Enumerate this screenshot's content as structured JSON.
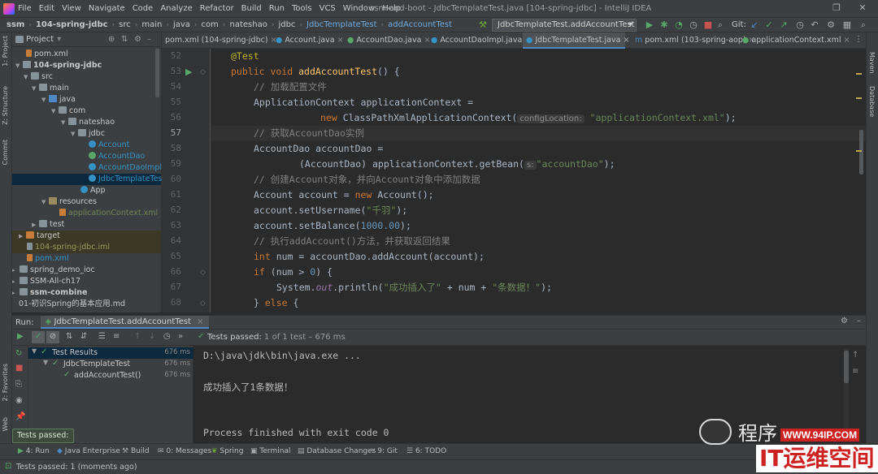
{
  "menu": [
    "File",
    "Edit",
    "View",
    "Navigate",
    "Code",
    "Analyze",
    "Refactor",
    "Build",
    "Run",
    "Tools",
    "VCS",
    "Window",
    "Help"
  ],
  "window_title": "ssm-and-boot - JdbcTemplateTest.java [104-spring-jdbc] - IntelliJ IDEA",
  "breadcrumbs": [
    "ssm",
    "104-spring-jdbc",
    "src",
    "main",
    "java",
    "com",
    "nateshao",
    "jdbc",
    "JdbcTemplateTest",
    "addAccountTest"
  ],
  "run_config": "JdbcTemplateTest.addAccountTest",
  "git_label": "Git:",
  "project_panel": {
    "title": "Project",
    "items": [
      {
        "label": "pom.xml",
        "indent": 1
      },
      {
        "label": "104-spring-jdbc",
        "indent": 0
      },
      {
        "label": "src",
        "indent": 1
      },
      {
        "label": "main",
        "indent": 2
      },
      {
        "label": "java",
        "indent": 3
      },
      {
        "label": "com",
        "indent": 4
      },
      {
        "label": "nateshao",
        "indent": 5
      },
      {
        "label": "jdbc",
        "indent": 6
      },
      {
        "label": "Account",
        "indent": 7
      },
      {
        "label": "AccountDao",
        "indent": 7
      },
      {
        "label": "AccountDaoImpl",
        "indent": 7
      },
      {
        "label": "JdbcTemplateTest",
        "indent": 7
      },
      {
        "label": "App",
        "indent": 6
      },
      {
        "label": "resources",
        "indent": 3
      },
      {
        "label": "applicationContext.xml",
        "indent": 4
      },
      {
        "label": "test",
        "indent": 2
      },
      {
        "label": "target",
        "indent": 1
      },
      {
        "label": "104-spring-jdbc.iml",
        "indent": 1
      },
      {
        "label": "pom.xml",
        "indent": 1
      },
      {
        "label": "spring_demo_ioc",
        "indent": 0
      },
      {
        "label": "SSM-All-ch17",
        "indent": 0
      },
      {
        "label": "ssm-combine",
        "indent": 0
      },
      {
        "label": "01-初识Spring的基本应用.md",
        "indent": 0
      }
    ]
  },
  "left_strip": [
    "1: Project",
    "Z: Structure",
    "Commit"
  ],
  "left_strip_bottom": [
    "2: Favorites",
    "Web"
  ],
  "right_strip": [
    "Maven",
    "Database"
  ],
  "editor_tabs": [
    "pom.xml (104-spring-jdbc)",
    "Account.java",
    "AccountDao.java",
    "AccountDaoImpl.java",
    "JdbcTemplateTest.java",
    "pom.xml (103-spring-aop)",
    "applicationContext.xml"
  ],
  "line_numbers": [
    "52",
    "53",
    "54",
    "55",
    "56",
    "57",
    "58",
    "59",
    "60",
    "61",
    "62",
    "63",
    "64",
    "65",
    "66",
    "67",
    "68"
  ],
  "code": {
    "l52": "@Test",
    "l53_kw": "public void ",
    "l53_fn": "addAccountTest",
    "l53_rest": "() {",
    "l54": "// 加载配置文件",
    "l55": "ApplicationContext applicationContext =",
    "l56_kw": "new ",
    "l56_cls": "ClassPathXmlApplicationContext(",
    "l56_hint": "configLocation:",
    "l56_str": "\"applicationContext.xml\"",
    "l56_end": ");",
    "l57": "// 获取AccountDao实例",
    "l58": "AccountDao accountDao =",
    "l59_a": "(AccountDao) applicationContext.getBean(",
    "l59_hint": "s:",
    "l59_str": "\"accountDao\"",
    "l59_end": ");",
    "l60": "// 创建Account对象，并向Account对象中添加数据",
    "l61_a": "Account account = ",
    "l61_kw": "new ",
    "l61_b": "Account();",
    "l62_a": "account.setUsername(",
    "l62_str": "\"千羽\"",
    "l62_b": ");",
    "l63_a": "account.setBalance(",
    "l63_num": "1000.00",
    "l63_b": ");",
    "l64": "// 执行addAccount()方法，并获取返回结果",
    "l65_kw": "int ",
    "l65_b": "num = accountDao.addAccount(account);",
    "l66_kw": "if ",
    "l66_a": "(num > ",
    "l66_num": "0",
    "l66_b": ") {",
    "l67_a": "System.",
    "l67_out": "out",
    "l67_b": ".println(",
    "l67_s1": "\"成功插入了\"",
    "l67_c": " + num + ",
    "l67_s2": "\"条数据！\"",
    "l67_d": ");",
    "l68_a": "} ",
    "l68_kw": "else ",
    "l68_b": "{"
  },
  "run_panel": {
    "label": "Run:",
    "tab": "JdbcTemplateTest.addAccountTest",
    "status_prefix": "Tests passed:",
    "status_rest": "1 of 1 test – 676 ms",
    "tree": [
      {
        "label": "Test Results",
        "time": "676 ms"
      },
      {
        "label": "JdbcTemplateTest",
        "time": "676 ms"
      },
      {
        "label": "addAccountTest()",
        "time": "676 ms"
      }
    ],
    "console": [
      "D:\\java\\jdk\\bin\\java.exe ...",
      "成功插入了1条数据！",
      "Process finished with exit code 0"
    ]
  },
  "tooltip": "Tests passed: 1",
  "bottom_tools": [
    "4: Run",
    "Java Enterprise",
    "Build",
    "0: Messages",
    "Spring",
    "Terminal",
    "Database Changes",
    "9: Git",
    "6: TODO"
  ],
  "status_text": "Tests passed: 1 (moments ago)",
  "watermark": {
    "cn": "程序",
    "url": "WWW.94IP.COM",
    "brand": "IT运维空间"
  }
}
